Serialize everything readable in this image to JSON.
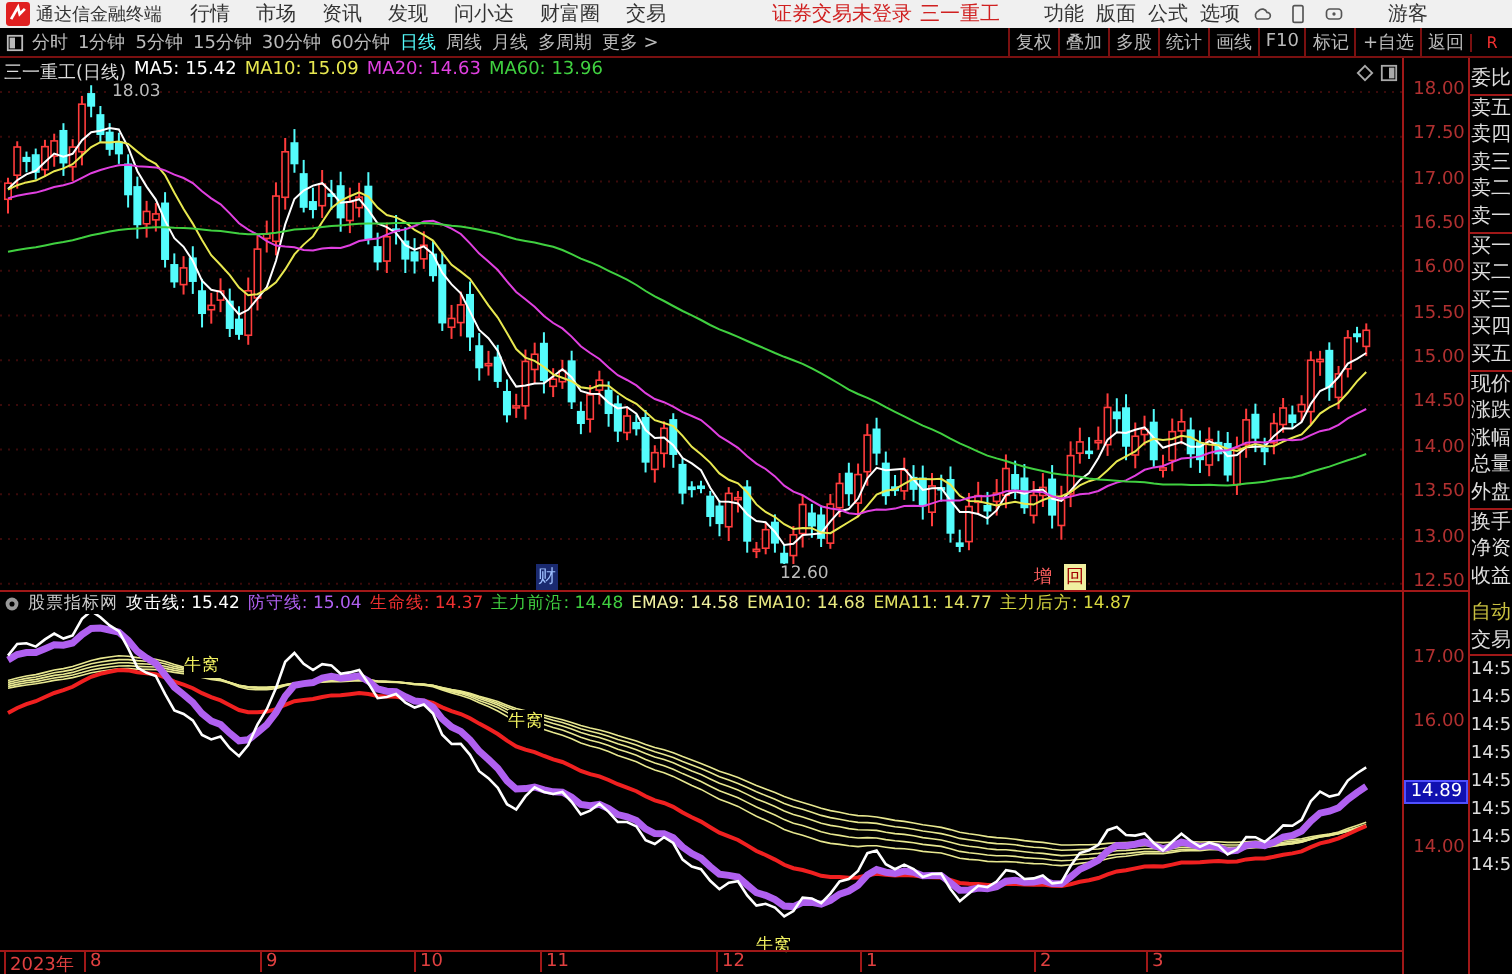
{
  "menu_bar": {
    "app_name": "通达信金融终端",
    "menus": [
      "行情",
      "市场",
      "资讯",
      "发现",
      "问小达",
      "财富圈",
      "交易"
    ],
    "login_status": "证券交易未登录",
    "stock_name": "三一重工",
    "tools": [
      "功能",
      "版面",
      "公式",
      "选项"
    ],
    "user": "游客"
  },
  "toolbar": {
    "periods": [
      {
        "label": "分时",
        "selected": false
      },
      {
        "label": "1分钟",
        "selected": false
      },
      {
        "label": "5分钟",
        "selected": false
      },
      {
        "label": "15分钟",
        "selected": false
      },
      {
        "label": "30分钟",
        "selected": false
      },
      {
        "label": "60分钟",
        "selected": false
      },
      {
        "label": "日线",
        "selected": true
      },
      {
        "label": "周线",
        "selected": false
      },
      {
        "label": "月线",
        "selected": false
      },
      {
        "label": "多周期",
        "selected": false
      },
      {
        "label": "更多 >",
        "selected": false
      }
    ],
    "actions": [
      "复权",
      "叠加",
      "多股",
      "统计",
      "画线",
      "F10",
      "标记",
      "+自选",
      "返回"
    ],
    "corner_label": "R"
  },
  "price_chart": {
    "title": "三一重工(日线)",
    "legend": [
      {
        "label": "MA5:",
        "value": "15.42",
        "color": "#ffffff"
      },
      {
        "label": "MA10:",
        "value": "15.09",
        "color": "#e8e850"
      },
      {
        "label": "MA20:",
        "value": "14.63",
        "color": "#e040e0"
      },
      {
        "label": "MA60:",
        "value": "13.96",
        "color": "#40d040"
      }
    ],
    "high_label": "18.03",
    "low_label": "12.60",
    "markers": [
      "财",
      "增",
      "回"
    ],
    "axis_labels": [
      "18.00",
      "17.50",
      "17.00",
      "16.50",
      "16.00",
      "15.50",
      "15.00",
      "14.50",
      "14.00",
      "13.50",
      "13.00",
      "12.50"
    ]
  },
  "indicator_chart": {
    "name": "股票指标网",
    "legend": [
      {
        "label": "攻击线:",
        "value": "15.42",
        "color": "#ffffff"
      },
      {
        "label": "防守线:",
        "value": "15.04",
        "color": "#b060f0"
      },
      {
        "label": "生命线:",
        "value": "14.37",
        "color": "#f03030"
      },
      {
        "label": "主力前沿:",
        "value": "14.48",
        "color": "#40d040"
      },
      {
        "label": "EMA9:",
        "value": "14.58",
        "color": "#f0f0a0"
      },
      {
        "label": "EMA10:",
        "value": "14.68",
        "color": "#e8e880"
      },
      {
        "label": "EMA11:",
        "value": "14.77",
        "color": "#e0e060"
      },
      {
        "label": "主力后方:",
        "value": "14.87",
        "color": "#d8d840"
      }
    ],
    "signals": [
      "牛窝",
      "牛窝",
      "牛窝"
    ],
    "axis_labels": [
      {
        "text": "17.00",
        "selected": false
      },
      {
        "text": "16.00",
        "selected": false
      },
      {
        "text": "14.89",
        "selected": true
      },
      {
        "text": "14.00",
        "selected": false
      }
    ]
  },
  "date_axis": [
    "2023年",
    "8",
    "9",
    "10",
    "11",
    "12",
    "1",
    "2",
    "3"
  ],
  "quote_panel": {
    "fields": [
      "委比",
      "卖五",
      "卖四",
      "卖三",
      "卖二",
      "卖一",
      "买一",
      "买二",
      "买三",
      "买四",
      "买五",
      "现价",
      "涨跌",
      "涨幅",
      "总量",
      "外盘",
      "换手",
      "净资",
      "收益"
    ],
    "mode": "自动",
    "trade": "交易",
    "times": [
      "14:5",
      "14:5",
      "14:5",
      "14:5",
      "14:5",
      "14:5",
      "14:5",
      "14:5"
    ]
  }
}
